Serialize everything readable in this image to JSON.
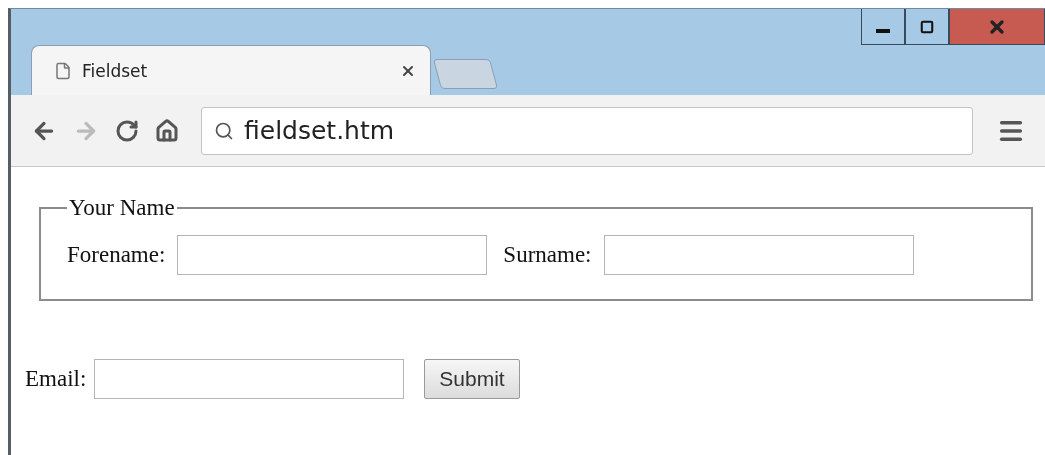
{
  "tabs": [
    {
      "label": "Fieldset",
      "selected": true
    }
  ],
  "toolbar": {
    "nav": [
      {
        "kind": "back",
        "disabled": false
      },
      {
        "kind": "forward",
        "disabled": true
      },
      {
        "kind": "reload",
        "disabled": false
      },
      {
        "kind": "home",
        "disabled": false
      }
    ],
    "address": "fieldset.htm"
  },
  "fieldset": {
    "legend": "Your Name",
    "fields": [
      {
        "label": "Forename:"
      },
      {
        "label": "Surname:"
      }
    ]
  },
  "email": {
    "label": "Email:"
  },
  "submit": "Submit"
}
